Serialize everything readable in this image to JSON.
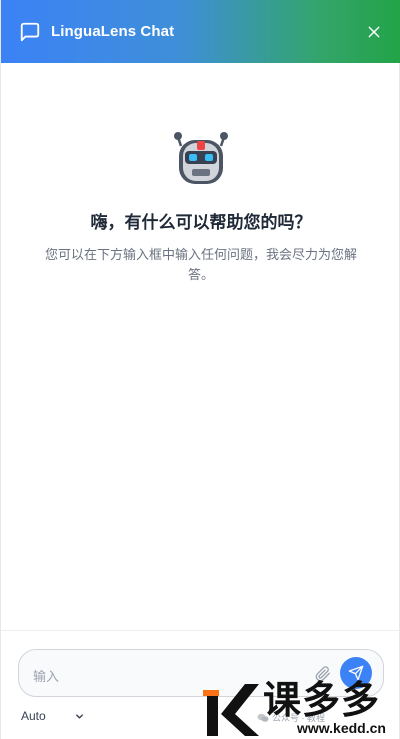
{
  "header": {
    "title": "LinguaLens Chat",
    "icon": "chat-bubble-icon",
    "close_icon": "close-icon",
    "gradient": [
      "#3b82f6",
      "#22a447"
    ]
  },
  "welcome": {
    "icon": "robot-icon",
    "heading": "嗨，有什么可以帮助您的吗？",
    "subtext": "您可以在下方输入框中输入任何问题，我会尽力为您解答。"
  },
  "composer": {
    "placeholder": "输入",
    "value": "",
    "attach_icon": "paperclip-icon",
    "send_icon": "send-icon",
    "send_color": "#3b82f6"
  },
  "language": {
    "selected": "Auto"
  },
  "watermark": {
    "brand": "课多多",
    "url": "www.kedd.cn",
    "wechat": "公众号 · 教程"
  }
}
